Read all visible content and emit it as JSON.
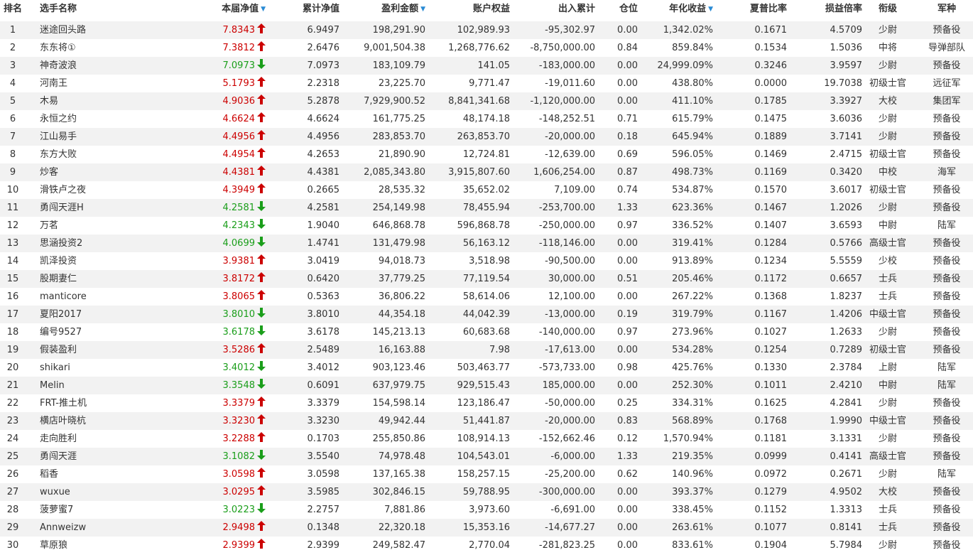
{
  "colors": {
    "up": "#cc0000",
    "down": "#1a9e1a",
    "sort_caret": "#2a8bd4",
    "stripe": "#f2f2f2"
  },
  "headers": {
    "rank": "排名",
    "name": "选手名称",
    "nav": "本届净值",
    "cum_nav": "累计净值",
    "profit": "盈利金额",
    "equity": "账户权益",
    "flow": "出入累计",
    "position": "仓位",
    "annual": "年化收益",
    "sharpe": "夏普比率",
    "pl_ratio": "损益倍率",
    "rank_title": "衔级",
    "branch": "军种"
  },
  "sortable": [
    "nav",
    "profit",
    "annual"
  ],
  "rows": [
    {
      "rank": "1",
      "name": "迷途回头路",
      "nav": "7.8343",
      "dir": "up",
      "cum_nav": "6.9497",
      "profit": "198,291.90",
      "equity": "102,989.93",
      "flow": "-95,302.97",
      "position": "0.00",
      "annual": "1,342.02%",
      "sharpe": "0.1671",
      "pl_ratio": "4.5709",
      "rank_title": "少尉",
      "branch": "预备役"
    },
    {
      "rank": "2",
      "name": "东东将①",
      "nav": "7.3812",
      "dir": "up",
      "cum_nav": "2.6476",
      "profit": "9,001,504.38",
      "equity": "1,268,776.62",
      "flow": "-8,750,000.00",
      "position": "0.84",
      "annual": "859.84%",
      "sharpe": "0.1534",
      "pl_ratio": "1.5036",
      "rank_title": "中将",
      "branch": "导弹部队"
    },
    {
      "rank": "3",
      "name": "神奇波浪",
      "nav": "7.0973",
      "dir": "down",
      "cum_nav": "7.0973",
      "profit": "183,109.79",
      "equity": "141.05",
      "flow": "-183,000.00",
      "position": "0.00",
      "annual": "24,999.09%",
      "sharpe": "0.3246",
      "pl_ratio": "3.9597",
      "rank_title": "少尉",
      "branch": "预备役"
    },
    {
      "rank": "4",
      "name": "河南王",
      "nav": "5.1793",
      "dir": "up",
      "cum_nav": "2.2318",
      "profit": "23,225.70",
      "equity": "9,771.47",
      "flow": "-19,011.60",
      "position": "0.00",
      "annual": "438.80%",
      "sharpe": "0.0000",
      "pl_ratio": "19.7038",
      "rank_title": "初级士官",
      "branch": "远征军"
    },
    {
      "rank": "5",
      "name": "木易",
      "nav": "4.9036",
      "dir": "up",
      "cum_nav": "5.2878",
      "profit": "7,929,900.52",
      "equity": "8,841,341.68",
      "flow": "-1,120,000.00",
      "position": "0.00",
      "annual": "411.10%",
      "sharpe": "0.1785",
      "pl_ratio": "3.3927",
      "rank_title": "大校",
      "branch": "集团军"
    },
    {
      "rank": "6",
      "name": "永恒之约",
      "nav": "4.6624",
      "dir": "up",
      "cum_nav": "4.6624",
      "profit": "161,775.25",
      "equity": "48,174.18",
      "flow": "-148,252.51",
      "position": "0.71",
      "annual": "615.79%",
      "sharpe": "0.1475",
      "pl_ratio": "3.6036",
      "rank_title": "少尉",
      "branch": "预备役"
    },
    {
      "rank": "7",
      "name": "江山易手",
      "nav": "4.4956",
      "dir": "up",
      "cum_nav": "4.4956",
      "profit": "283,853.70",
      "equity": "263,853.70",
      "flow": "-20,000.00",
      "position": "0.18",
      "annual": "645.94%",
      "sharpe": "0.1889",
      "pl_ratio": "3.7141",
      "rank_title": "少尉",
      "branch": "预备役"
    },
    {
      "rank": "8",
      "name": "东方大败",
      "nav": "4.4954",
      "dir": "up",
      "cum_nav": "4.2653",
      "profit": "21,890.90",
      "equity": "12,724.81",
      "flow": "-12,639.00",
      "position": "0.69",
      "annual": "596.05%",
      "sharpe": "0.1469",
      "pl_ratio": "2.4715",
      "rank_title": "初级士官",
      "branch": "预备役"
    },
    {
      "rank": "9",
      "name": "炒客",
      "nav": "4.4381",
      "dir": "up",
      "cum_nav": "4.4381",
      "profit": "2,085,343.80",
      "equity": "3,915,807.60",
      "flow": "1,606,254.00",
      "position": "0.87",
      "annual": "498.73%",
      "sharpe": "0.1169",
      "pl_ratio": "0.3420",
      "rank_title": "中校",
      "branch": "海军"
    },
    {
      "rank": "10",
      "name": "滑铁卢之夜",
      "nav": "4.3949",
      "dir": "up",
      "cum_nav": "0.2665",
      "profit": "28,535.32",
      "equity": "35,652.02",
      "flow": "7,109.00",
      "position": "0.74",
      "annual": "534.87%",
      "sharpe": "0.1570",
      "pl_ratio": "3.6017",
      "rank_title": "初级士官",
      "branch": "预备役"
    },
    {
      "rank": "11",
      "name": "勇闯天涯H",
      "nav": "4.2581",
      "dir": "down",
      "cum_nav": "4.2581",
      "profit": "254,149.98",
      "equity": "78,455.94",
      "flow": "-253,700.00",
      "position": "1.33",
      "annual": "623.36%",
      "sharpe": "0.1467",
      "pl_ratio": "1.2026",
      "rank_title": "少尉",
      "branch": "预备役"
    },
    {
      "rank": "12",
      "name": "万茗",
      "nav": "4.2343",
      "dir": "down",
      "cum_nav": "1.9040",
      "profit": "646,868.78",
      "equity": "596,868.78",
      "flow": "-250,000.00",
      "position": "0.97",
      "annual": "336.52%",
      "sharpe": "0.1407",
      "pl_ratio": "3.6593",
      "rank_title": "中尉",
      "branch": "陆军"
    },
    {
      "rank": "13",
      "name": "思涵投资2",
      "nav": "4.0699",
      "dir": "down",
      "cum_nav": "1.4741",
      "profit": "131,479.98",
      "equity": "56,163.12",
      "flow": "-118,146.00",
      "position": "0.00",
      "annual": "319.41%",
      "sharpe": "0.1284",
      "pl_ratio": "0.5766",
      "rank_title": "高级士官",
      "branch": "预备役"
    },
    {
      "rank": "14",
      "name": "凯泽投资",
      "nav": "3.9381",
      "dir": "up",
      "cum_nav": "3.0419",
      "profit": "94,018.73",
      "equity": "3,518.98",
      "flow": "-90,500.00",
      "position": "0.00",
      "annual": "913.89%",
      "sharpe": "0.1234",
      "pl_ratio": "5.5559",
      "rank_title": "少校",
      "branch": "预备役"
    },
    {
      "rank": "15",
      "name": "股期妻仁",
      "nav": "3.8172",
      "dir": "up",
      "cum_nav": "0.6420",
      "profit": "37,779.25",
      "equity": "77,119.54",
      "flow": "30,000.00",
      "position": "0.51",
      "annual": "205.46%",
      "sharpe": "0.1172",
      "pl_ratio": "0.6657",
      "rank_title": "士兵",
      "branch": "预备役"
    },
    {
      "rank": "16",
      "name": "manticore",
      "nav": "3.8065",
      "dir": "up",
      "cum_nav": "0.5363",
      "profit": "36,806.22",
      "equity": "58,614.06",
      "flow": "12,100.00",
      "position": "0.00",
      "annual": "267.22%",
      "sharpe": "0.1368",
      "pl_ratio": "1.8237",
      "rank_title": "士兵",
      "branch": "预备役"
    },
    {
      "rank": "17",
      "name": "夏阳2017",
      "nav": "3.8010",
      "dir": "down",
      "cum_nav": "3.8010",
      "profit": "44,354.18",
      "equity": "44,042.39",
      "flow": "-13,000.00",
      "position": "0.19",
      "annual": "319.79%",
      "sharpe": "0.1167",
      "pl_ratio": "1.4206",
      "rank_title": "中级士官",
      "branch": "预备役"
    },
    {
      "rank": "18",
      "name": "编号9527",
      "nav": "3.6178",
      "dir": "down",
      "cum_nav": "3.6178",
      "profit": "145,213.13",
      "equity": "60,683.68",
      "flow": "-140,000.00",
      "position": "0.97",
      "annual": "273.96%",
      "sharpe": "0.1027",
      "pl_ratio": "1.2633",
      "rank_title": "少尉",
      "branch": "预备役"
    },
    {
      "rank": "19",
      "name": "假装盈利",
      "nav": "3.5286",
      "dir": "up",
      "cum_nav": "2.5489",
      "profit": "16,163.88",
      "equity": "7.98",
      "flow": "-17,613.00",
      "position": "0.00",
      "annual": "534.28%",
      "sharpe": "0.1254",
      "pl_ratio": "0.7289",
      "rank_title": "初级士官",
      "branch": "预备役"
    },
    {
      "rank": "20",
      "name": "shikari",
      "nav": "3.4012",
      "dir": "down",
      "cum_nav": "3.4012",
      "profit": "903,123.46",
      "equity": "503,463.77",
      "flow": "-573,733.00",
      "position": "0.98",
      "annual": "425.76%",
      "sharpe": "0.1330",
      "pl_ratio": "2.3784",
      "rank_title": "上尉",
      "branch": "陆军"
    },
    {
      "rank": "21",
      "name": "Melin",
      "nav": "3.3548",
      "dir": "down",
      "cum_nav": "0.6091",
      "profit": "637,979.75",
      "equity": "929,515.43",
      "flow": "185,000.00",
      "position": "0.00",
      "annual": "252.30%",
      "sharpe": "0.1011",
      "pl_ratio": "2.4210",
      "rank_title": "中尉",
      "branch": "陆军"
    },
    {
      "rank": "22",
      "name": "FRT-推土机",
      "nav": "3.3379",
      "dir": "up",
      "cum_nav": "3.3379",
      "profit": "154,598.14",
      "equity": "123,186.47",
      "flow": "-50,000.00",
      "position": "0.25",
      "annual": "334.31%",
      "sharpe": "0.1625",
      "pl_ratio": "4.2841",
      "rank_title": "少尉",
      "branch": "预备役"
    },
    {
      "rank": "23",
      "name": "横店叶晓杭",
      "nav": "3.3230",
      "dir": "up",
      "cum_nav": "3.3230",
      "profit": "49,942.44",
      "equity": "51,441.87",
      "flow": "-20,000.00",
      "position": "0.83",
      "annual": "568.89%",
      "sharpe": "0.1768",
      "pl_ratio": "1.9990",
      "rank_title": "中级士官",
      "branch": "预备役"
    },
    {
      "rank": "24",
      "name": "走向胜利",
      "nav": "3.2288",
      "dir": "up",
      "cum_nav": "0.1703",
      "profit": "255,850.86",
      "equity": "108,914.13",
      "flow": "-152,662.46",
      "position": "0.12",
      "annual": "1,570.94%",
      "sharpe": "0.1181",
      "pl_ratio": "3.1331",
      "rank_title": "少尉",
      "branch": "预备役"
    },
    {
      "rank": "25",
      "name": "勇闯天涯",
      "nav": "3.1082",
      "dir": "down",
      "cum_nav": "3.5540",
      "profit": "74,978.48",
      "equity": "104,543.01",
      "flow": "-6,000.00",
      "position": "1.33",
      "annual": "219.35%",
      "sharpe": "0.0999",
      "pl_ratio": "0.4141",
      "rank_title": "高级士官",
      "branch": "预备役"
    },
    {
      "rank": "26",
      "name": "稻香",
      "nav": "3.0598",
      "dir": "up",
      "cum_nav": "3.0598",
      "profit": "137,165.38",
      "equity": "158,257.15",
      "flow": "-25,200.00",
      "position": "0.62",
      "annual": "140.96%",
      "sharpe": "0.0972",
      "pl_ratio": "0.2671",
      "rank_title": "少尉",
      "branch": "陆军"
    },
    {
      "rank": "27",
      "name": "wuxue",
      "nav": "3.0295",
      "dir": "up",
      "cum_nav": "3.5985",
      "profit": "302,846.15",
      "equity": "59,788.95",
      "flow": "-300,000.00",
      "position": "0.00",
      "annual": "393.37%",
      "sharpe": "0.1279",
      "pl_ratio": "4.9502",
      "rank_title": "大校",
      "branch": "预备役"
    },
    {
      "rank": "28",
      "name": "菠萝蜜7",
      "nav": "3.0223",
      "dir": "down",
      "cum_nav": "2.2757",
      "profit": "7,881.86",
      "equity": "3,973.60",
      "flow": "-6,691.00",
      "position": "0.00",
      "annual": "338.45%",
      "sharpe": "0.1152",
      "pl_ratio": "1.3313",
      "rank_title": "士兵",
      "branch": "预备役"
    },
    {
      "rank": "29",
      "name": "Annweizw",
      "nav": "2.9498",
      "dir": "up",
      "cum_nav": "0.1348",
      "profit": "22,320.18",
      "equity": "15,353.16",
      "flow": "-14,677.27",
      "position": "0.00",
      "annual": "263.61%",
      "sharpe": "0.1077",
      "pl_ratio": "0.8141",
      "rank_title": "士兵",
      "branch": "预备役"
    },
    {
      "rank": "30",
      "name": "草原狼",
      "nav": "2.9399",
      "dir": "up",
      "cum_nav": "2.9399",
      "profit": "249,582.47",
      "equity": "2,770.04",
      "flow": "-281,823.25",
      "position": "0.00",
      "annual": "833.61%",
      "sharpe": "0.1904",
      "pl_ratio": "5.7984",
      "rank_title": "少尉",
      "branch": "预备役"
    }
  ]
}
